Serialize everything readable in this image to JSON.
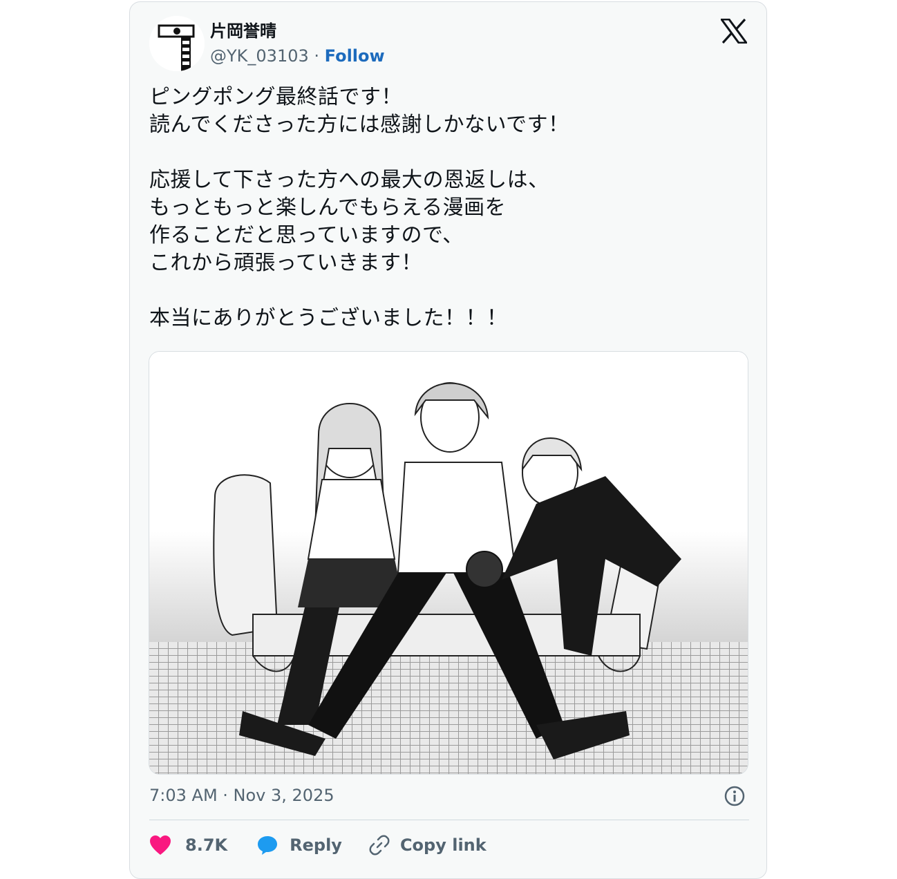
{
  "author": {
    "name": "片岡誉晴",
    "handle": "@YK_03103",
    "separator": "·",
    "follow_label": "Follow"
  },
  "icons": {
    "brand": "x-logo-icon",
    "info": "info-icon",
    "like": "heart-icon",
    "reply": "speech-bubble-icon",
    "copy": "link-icon"
  },
  "tweet": {
    "text": "ピングポング最終話です！\n読んでくださった方には感謝しかないです！\n\n応援して下さった方への最大の恩返しは、\nもっともっと楽しんでもらえる漫画を\n作ることだと思っていますので、\nこれから頑張っていきます！\n\n本当にありがとうございました！！！",
    "timestamp": "7:03 AM · Nov 3, 2025"
  },
  "media": {
    "description": "manga illustration"
  },
  "actions": {
    "like_count": "8.7K",
    "reply_label": "Reply",
    "copy_label": "Copy link"
  },
  "colors": {
    "follow": "#1d6bbd",
    "heart": "#f91880",
    "reply_bubble": "#1d9bf0",
    "muted": "#536471",
    "card_bg": "#f7f9f9"
  }
}
